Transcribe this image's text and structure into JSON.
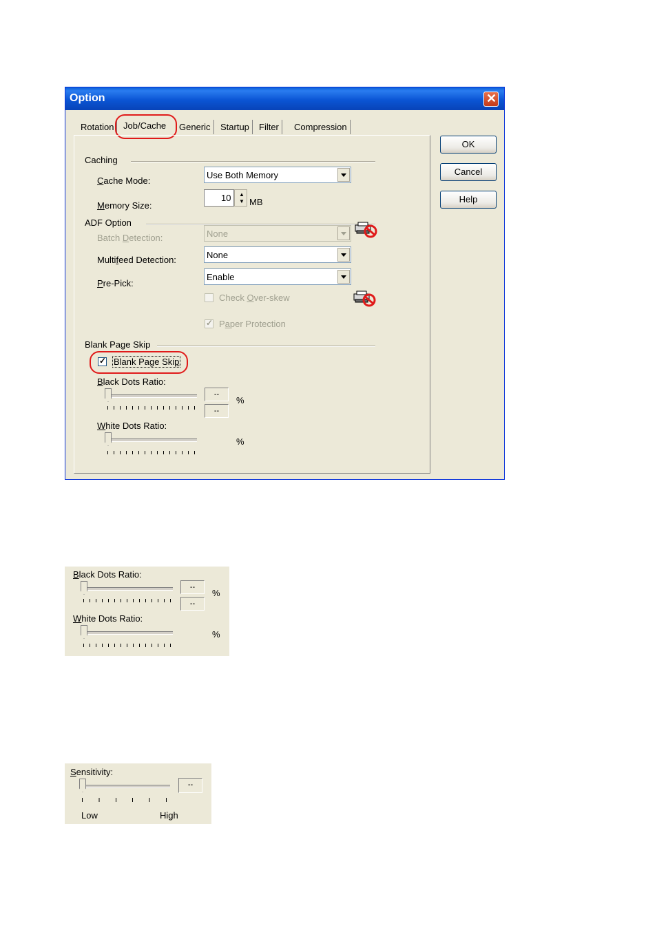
{
  "dialog": {
    "title": "Option",
    "close_label": "✕",
    "tabs": [
      "Rotation",
      "Job/Cache",
      "Generic",
      "Startup",
      "Filter",
      "Compression"
    ],
    "selected_tab": "Job/Cache",
    "buttons": {
      "ok": "OK",
      "cancel": "Cancel",
      "help": "Help"
    },
    "caching": {
      "group_label": "Caching",
      "cache_mode_label_pre": "",
      "cache_mode_label_ul": "C",
      "cache_mode_label_post": "ache Mode:",
      "cache_mode_value": "Use Both Memory",
      "memory_label_ul": "M",
      "memory_label_post": "emory Size:",
      "memory_value": "10",
      "memory_unit": "MB"
    },
    "adf": {
      "group_label": "ADF Option",
      "batch_label_pre": "Batch ",
      "batch_label_ul": "D",
      "batch_label_post": "etection:",
      "batch_value": "None",
      "multifeed_label_pre": "Multi",
      "multifeed_label_ul": "f",
      "multifeed_label_post": "eed Detection:",
      "multifeed_value": "None",
      "prepick_label_ul": "P",
      "prepick_label_post": "re-Pick:",
      "prepick_value": "Enable",
      "overskew_label_pre": "Check ",
      "overskew_label_ul": "O",
      "overskew_label_post": "ver-skew",
      "paper_label_pre": "P",
      "paper_label_ul": "a",
      "paper_label_post": "per Protection"
    },
    "blank": {
      "group_label": "Blank Page Skip",
      "checkbox_label_pre": "Blank Page Ski",
      "checkbox_label_ul": "p",
      "checked": true,
      "black_label_ul": "B",
      "black_label_post": "lack Dots Ratio:",
      "white_label_ul": "W",
      "white_label_post": "hite Dots Ratio:",
      "value_placeholder": "--",
      "percent": "%"
    }
  },
  "snippet1": {
    "black_label_ul": "B",
    "black_label_post": "lack Dots Ratio:",
    "white_label_ul": "W",
    "white_label_post": "hite Dots Ratio:",
    "value_placeholder": "--",
    "percent": "%"
  },
  "snippet2": {
    "label_ul": "S",
    "label_post": "ensitivity:",
    "value_placeholder": "--",
    "low": "Low",
    "high": "High"
  },
  "colors": {
    "titlebar": "#0a5fd8",
    "dialog_bg": "#ece9d8",
    "highlight_ring": "#e01a1a"
  },
  "icons": [
    "close-icon",
    "dropdown-arrow-icon",
    "scanner-no-icon",
    "checkmark-icon",
    "slider-thumb-icon"
  ]
}
